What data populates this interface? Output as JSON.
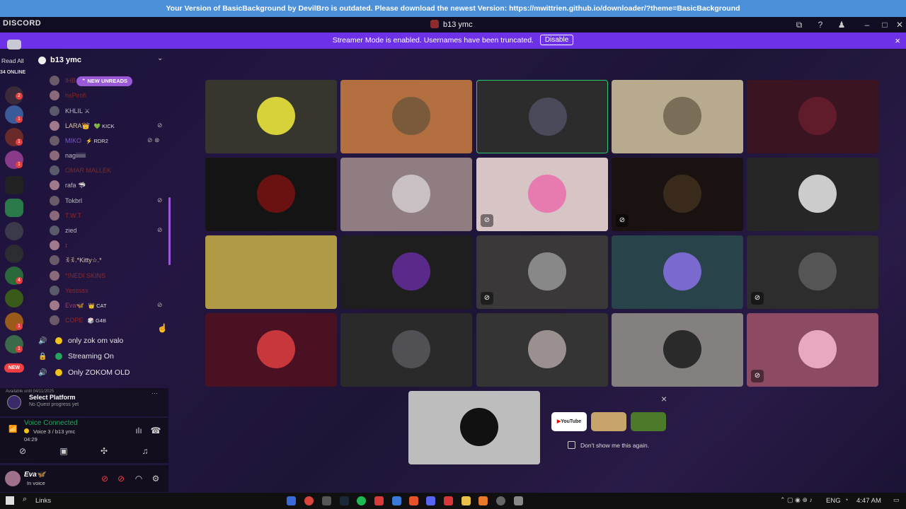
{
  "banner": {
    "message": "Your Version of  BasicBackground  by DevilBro is outdated. Please download the newest Version:  https://mwittrien.github.io/downloader/?theme=BasicBackground"
  },
  "titlebar": {
    "brand": "DISCORD",
    "title": "b13 ymc"
  },
  "streamer": {
    "message": "Streamer Mode is enabled. Usernames have been truncated.",
    "disable_label": "Disable",
    "close_glyph": "×"
  },
  "guilds": {
    "read_all": "Read All",
    "online": "34 ONLINE",
    "new_label": "NEW"
  },
  "server": {
    "name": "b13 ymc",
    "new_unreads": "NEW UNREADS"
  },
  "members": [
    {
      "name": "IHB",
      "color": "#8f2a2a"
    },
    {
      "name": "hsPirofi",
      "color": "#7a2b2b"
    },
    {
      "name": "KHLIL ⚔",
      "color": "#b9bbbe"
    },
    {
      "name": "LARA👑",
      "activity": "💚 KICK",
      "color": "#e0c9a0"
    },
    {
      "name": "MIKO",
      "activity": "⚡ RDR2",
      "color": "#7a5cc7"
    },
    {
      "name": "nagiiiiiii",
      "color": "#b9bbbe"
    },
    {
      "name": "OMAR MALLEK",
      "color": "#7a2b2b"
    },
    {
      "name": "rafa 🦈",
      "color": "#b9bbbe"
    },
    {
      "name": "Tokbrl",
      "color": "#b9bbbe"
    },
    {
      "name": "T.W.T",
      "color": "#8f2a2a"
    },
    {
      "name": "zied",
      "color": "#b9bbbe"
    },
    {
      "name": "ɪ",
      "color": "#8f2a2a"
    },
    {
      "name": "ꉂꉂ.*Kitty☆.*",
      "color": "#e0c9a0"
    },
    {
      "name": "*!NEDI SKINS",
      "color": "#8f2a2a"
    },
    {
      "name": "Yesssss",
      "color": "#8f2a2a"
    },
    {
      "name": "Eva🦋",
      "activity": "👑 CAT",
      "color": "#a23a6a"
    },
    {
      "name": "COPE",
      "activity": "🎲 G4B",
      "color": "#8f2a2a"
    }
  ],
  "voice_channels": [
    {
      "name": "only zok om valo",
      "dot": "#f0c419"
    },
    {
      "name": "Streaming On",
      "dot": "#23a55a"
    },
    {
      "name": "Only ZOKOM OLD",
      "dot": "#f0c419"
    }
  ],
  "quest": {
    "available_until": "Available until 04/11/2025",
    "title": "Select Platform",
    "subtitle": "No Quest progress yet",
    "more": "···"
  },
  "voice": {
    "status": "Voice Connected",
    "channel": "Voice 3 / b13 ymc",
    "timer": "04:29"
  },
  "user": {
    "name": "Eva🦋",
    "status": "In voice"
  },
  "popup": {
    "close_glyph": "×",
    "checkbox_label": "Don't show me this again.",
    "youtube": "YouTube",
    "app_colors": [
      "#ffffff",
      "#c7a46a",
      "#4a7a2a"
    ]
  },
  "tiles": [
    {
      "bg": "#36362e",
      "pic": "#d8d23a",
      "muted": false
    },
    {
      "bg": "#b36f3f",
      "pic": "#7a5a3a",
      "muted": false
    },
    {
      "bg": "#2c2c2c",
      "pic": "#4a4a5a",
      "muted": false,
      "speaking": true
    },
    {
      "bg": "#b7aa8f",
      "pic": "#7a6e58",
      "muted": false
    },
    {
      "bg": "#3a1521",
      "pic": "#601c2a",
      "muted": false
    },
    {
      "bg": "#141414",
      "pic": "#6a1212",
      "muted": false
    },
    {
      "bg": "#8f7d82",
      "pic": "#c9c0c4",
      "muted": false
    },
    {
      "bg": "#d7c5c6",
      "pic": "#e77bb0",
      "muted": true
    },
    {
      "bg": "#191210",
      "pic": "#3a2a1c",
      "muted": true
    },
    {
      "bg": "#262626",
      "pic": "#cccccc",
      "muted": false
    },
    {
      "bg": "#b19a45",
      "pic": "#b19a45",
      "muted": false
    },
    {
      "bg": "#1e1e1e",
      "pic": "#5a2a8a",
      "muted": false
    },
    {
      "bg": "#3a3838",
      "pic": "#888888",
      "muted": true
    },
    {
      "bg": "#29434b",
      "pic": "#7a6ad0",
      "muted": false
    },
    {
      "bg": "#2d2d2d",
      "pic": "#555555",
      "muted": true
    },
    {
      "bg": "#4a1123",
      "pic": "#c8373c",
      "muted": false
    },
    {
      "bg": "#2a2a2a",
      "pic": "#505055",
      "muted": false
    },
    {
      "bg": "#343434",
      "pic": "#9a9090",
      "muted": false
    },
    {
      "bg": "#858080",
      "pic": "#2a2a2a",
      "muted": false
    },
    {
      "bg": "#8d4a65",
      "pic": "#e9a8c2",
      "muted": true
    }
  ],
  "stream_preview": {
    "bg": "#bdbdbd",
    "pic": "#111111"
  },
  "taskbar": {
    "search": "Links",
    "lang": "ENG",
    "time": "4:47 AM"
  }
}
